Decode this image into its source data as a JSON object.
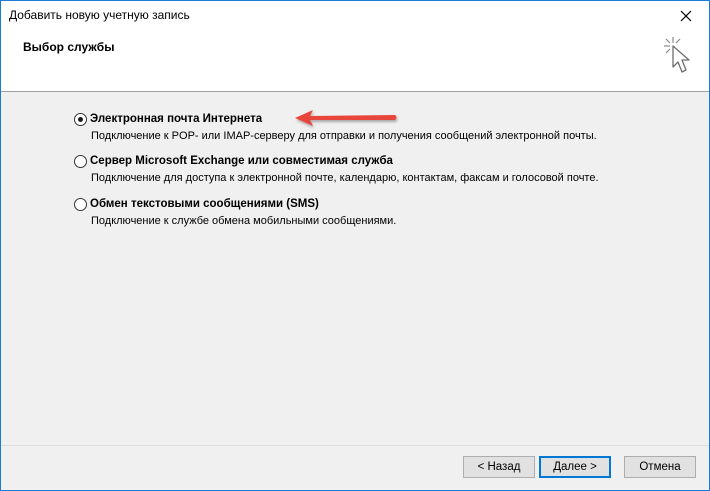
{
  "window": {
    "title": "Добавить новую учетную запись",
    "close_icon": "close-icon"
  },
  "header": {
    "title": "Выбор службы",
    "icon": "wizard-cursor-icon"
  },
  "options": [
    {
      "label": "Электронная почта Интернета",
      "description": "Подключение к POP- или IMAP-серверу для отправки и получения сообщений электронной почты.",
      "selected": true
    },
    {
      "label": "Сервер Microsoft Exchange или совместимая служба",
      "description": "Подключение для доступа к электронной почте, календарю, контактам, факсам и голосовой почте.",
      "selected": false
    },
    {
      "label": "Обмен текстовыми сообщениями (SMS)",
      "description": "Подключение к службе обмена мобильными сообщениями.",
      "selected": false
    }
  ],
  "annotation": {
    "arrow_color": "#e8443a"
  },
  "buttons": {
    "back": "< Назад",
    "next": "Далее >",
    "cancel": "Отмена"
  },
  "colors": {
    "window_border": "#1c7bd8",
    "content_bg": "#f0f0f0",
    "default_button_border": "#0078d7"
  }
}
